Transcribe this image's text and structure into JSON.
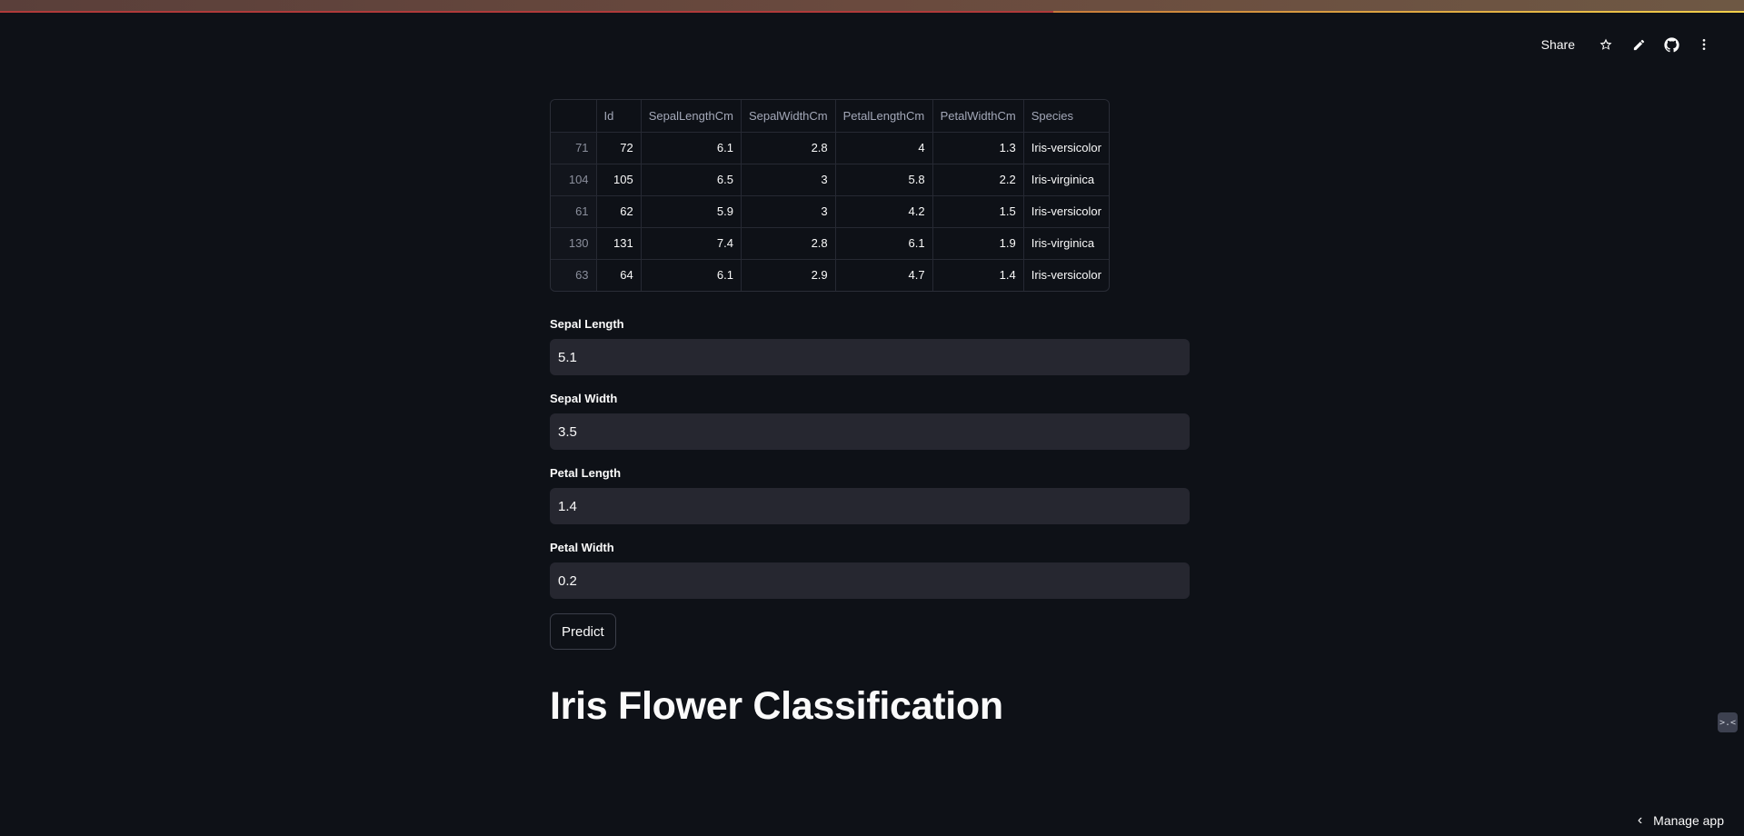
{
  "header": {
    "share_label": "Share",
    "icons": [
      "star-icon",
      "pencil-icon",
      "github-icon",
      "more-vertical-icon"
    ]
  },
  "dataframe": {
    "columns": [
      "",
      "Id",
      "SepalLengthCm",
      "SepalWidthCm",
      "PetalLengthCm",
      "PetalWidthCm",
      "Species"
    ],
    "rows": [
      {
        "index": "71",
        "Id": "72",
        "SepalLengthCm": "6.1",
        "SepalWidthCm": "2.8",
        "PetalLengthCm": "4",
        "PetalWidthCm": "1.3",
        "Species": "Iris-versicolor"
      },
      {
        "index": "104",
        "Id": "105",
        "SepalLengthCm": "6.5",
        "SepalWidthCm": "3",
        "PetalLengthCm": "5.8",
        "PetalWidthCm": "2.2",
        "Species": "Iris-virginica"
      },
      {
        "index": "61",
        "Id": "62",
        "SepalLengthCm": "5.9",
        "SepalWidthCm": "3",
        "PetalLengthCm": "4.2",
        "PetalWidthCm": "1.5",
        "Species": "Iris-versicolor"
      },
      {
        "index": "130",
        "Id": "131",
        "SepalLengthCm": "7.4",
        "SepalWidthCm": "2.8",
        "PetalLengthCm": "6.1",
        "PetalWidthCm": "1.9",
        "Species": "Iris-virginica"
      },
      {
        "index": "63",
        "Id": "64",
        "SepalLengthCm": "6.1",
        "SepalWidthCm": "2.9",
        "PetalLengthCm": "4.7",
        "PetalWidthCm": "1.4",
        "Species": "Iris-versicolor"
      }
    ]
  },
  "form": {
    "sepal_length": {
      "label": "Sepal Length",
      "value": "5.1"
    },
    "sepal_width": {
      "label": "Sepal Width",
      "value": "3.5"
    },
    "petal_length": {
      "label": "Petal Length",
      "value": "1.4"
    },
    "petal_width": {
      "label": "Petal Width",
      "value": "0.2"
    },
    "predict_label": "Predict"
  },
  "page_title": "Iris Flower Classification",
  "status_widget_text": ">.<",
  "footer": {
    "manage_app_label": "Manage app"
  },
  "colors": {
    "background": "#0e1117",
    "input_bg": "#262730",
    "text": "#fafafa"
  }
}
